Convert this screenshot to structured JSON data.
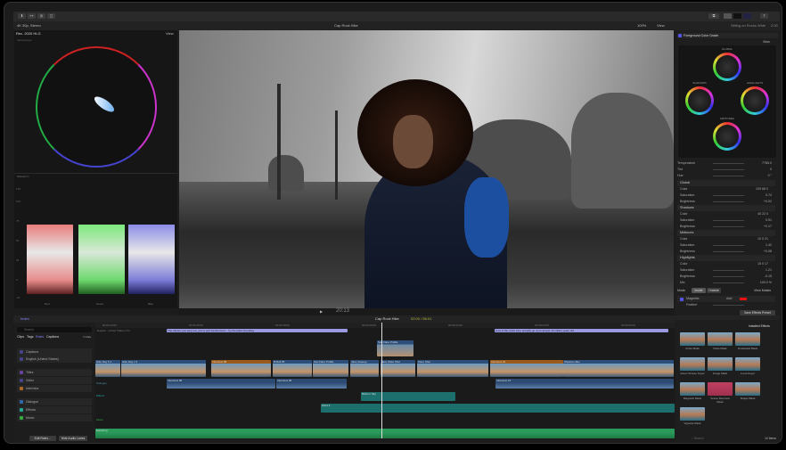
{
  "toolbar": {
    "icons": [
      "import-icon",
      "keyword-icon",
      "background-tasks-icon",
      "share-icon"
    ]
  },
  "header": {
    "format": "4K 30p, Stereo",
    "project": "Cap Rock Hike",
    "zoom": "100%",
    "view": "View"
  },
  "scopes": {
    "colorspace": "Rec. 2020 HLG",
    "view": "View",
    "vectorscope": "Vectorscope",
    "waveform": "Waveform",
    "ticks": [
      "120",
      "100",
      "75",
      "50",
      "25",
      "0",
      "-20"
    ],
    "channels": [
      "Red",
      "Green",
      "Blue"
    ]
  },
  "transport": {
    "timecode": "20:13"
  },
  "inspector": {
    "clip": "Sitting on Rocks Wide",
    "duration": "2:00",
    "effect": "Foreground Color Grade",
    "view": "View",
    "wheels": [
      "GLOBAL",
      "SHADOWS",
      "HIGHLIGHTS",
      "MIDTONES"
    ],
    "top": [
      {
        "label": "Temperature",
        "value": "7785.0"
      },
      {
        "label": "Tint",
        "value": "0"
      },
      {
        "label": "Hue",
        "value": "0 °"
      }
    ],
    "sections": [
      {
        "title": "Global",
        "color": "109   68   0",
        "saturation": "0.74",
        "brightness": "+0.02"
      },
      {
        "title": "Shadows",
        "color": "40   22   0",
        "saturation": "0.51",
        "brightness": "+0.17"
      },
      {
        "title": "Midtones",
        "color": "10   0   21",
        "saturation": "1.42",
        "brightness": "+0.08"
      },
      {
        "title": "Highlights",
        "color": "15   0   17",
        "saturation": "1.21",
        "brightness": "-0.15"
      }
    ],
    "labels": {
      "color": "Color",
      "saturation": "Saturation",
      "brightness": "Brightness",
      "mix": "Mix"
    },
    "mix": "100.0 %",
    "mode": "Mode",
    "inside": "Inside",
    "outside": "Outside",
    "view_masks": "View Masks",
    "mask": "Magnetic",
    "add": "Add",
    "feather": "Feather",
    "save": "Save Effects Preset"
  },
  "timeline_header": {
    "index": "Index",
    "project": "Cap Rock Hike",
    "position": "02:00 / 56:01"
  },
  "index": {
    "search_placeholder": "Search",
    "tabs": [
      "Clips",
      "Tags",
      "Roles",
      "Captions"
    ],
    "count": "7 roles",
    "roles": [
      "Captions",
      "English (United States)",
      "Titles",
      "Video",
      "Interview",
      "Dialogue",
      "Effects",
      "Music"
    ],
    "edit_roles": "Edit Roles…",
    "hide_audio": "Hide Audio Lanes"
  },
  "timeline": {
    "ruler": [
      "00:00:14:00",
      "00:00:16:00",
      "00:00:18:00",
      "00:00:20:00",
      "00:00:22:00",
      "00:00:24:00",
      "00:00:26:00"
    ],
    "caption_lang": "English - United States (T1)",
    "captions": [
      "The Interior you step out, you're just transformed… by the plant boundary",
      "A lot of the rocks here actually go up to almost 14 million years old."
    ],
    "connected": [
      "Sun Flare Profile"
    ],
    "primary": [
      "Hike Day 5.1",
      "Hike Day 1.6",
      "Interview 08",
      "B-Roll 05",
      "Sun Flare Profile",
      "Jace closeup",
      "Jace Wide Shot",
      "Pano Shot",
      "Interview 10",
      "Shadow Hike"
    ],
    "dialogue": [
      "Interview 08",
      "Interview 09",
      "Interview 13"
    ],
    "effects": [
      "Birds in Sky",
      "Wind 3"
    ],
    "music": [
      "Exploring"
    ],
    "lanes": [
      "Dialogue",
      "Effects",
      "Music"
    ]
  },
  "browser": {
    "title": "Installed Effects",
    "items": [
      "Circle Mask",
      "Draw Mask",
      "Graduated Mask",
      "Green Screen Keyer",
      "Image Mask",
      "Luma Keyer",
      "Magnetic Mask",
      "Scene Removal Mask",
      "Shape Mask",
      "Vignette Mask"
    ],
    "search_placeholder": "Search",
    "count": "10 Items"
  }
}
